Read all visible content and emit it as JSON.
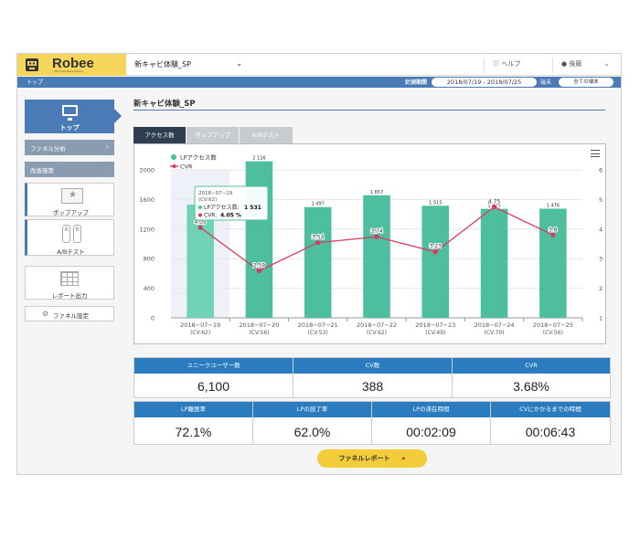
{
  "app": {
    "logo_text": "Robee",
    "logo_sub": "SPI Code Base Plugin",
    "project": "新キャビ体験_SP",
    "help": "ヘルプ",
    "user": "後藤"
  },
  "subbar": {
    "breadcrumb": "トップ",
    "period_label": "計測期間",
    "period_value": "2018/07/19 - 2018/07/25",
    "device_label": "端末",
    "device_value": "全ての端末"
  },
  "sidebar": {
    "top_label": "トップ",
    "funnel_label": "ファネル分析",
    "improve_label": "改善施策",
    "popup_label": "ポップアップ",
    "ab_label": "A/Bテスト",
    "ab_icon_a": "A",
    "ab_icon_b": "B",
    "report_label": "レポート出力",
    "setting_label": "ファネル設定"
  },
  "main": {
    "title": "新キャビ体験_SP",
    "tabs": [
      "アクセス数",
      "ポップアップ",
      "A/Bテスト"
    ]
  },
  "chart_data": {
    "type": "bar",
    "categories": [
      "2018−07−19",
      "2018−07−20",
      "2018−07−21",
      "2018−07−22",
      "2018−07−23",
      "2018−07−24",
      "2018−07−25"
    ],
    "cv_labels": [
      "(CV:62)",
      "(CV:56)",
      "(CV:53)",
      "(CV:62)",
      "(CV:49)",
      "(CV:70)",
      "(CV:56)"
    ],
    "series": [
      {
        "name": "LPアクセス数",
        "type": "bar",
        "axis": "left",
        "color": "#4dbf9e",
        "values": [
          1531,
          2116,
          1497,
          1657,
          1515,
          1473,
          1476
        ]
      },
      {
        "name": "CVR",
        "type": "line",
        "axis": "right",
        "color": "#d93a63",
        "values": [
          4.05,
          2.59,
          3.54,
          3.74,
          3.23,
          4.75,
          3.8
        ]
      }
    ],
    "bar_labels": [
      "1 531",
      "2 116",
      "1 497",
      "1 657",
      "1 515",
      "1 473",
      "1 476"
    ],
    "line_labels": [
      "4.05",
      "2.59",
      "3.54",
      "3.74",
      "3.23",
      "4.75",
      "3.8"
    ],
    "ylim_left": [
      0,
      2000
    ],
    "yticks_left": [
      "0",
      "400",
      "800",
      "1200",
      "1600",
      "2000"
    ],
    "ylim_right": [
      1,
      6
    ],
    "yticks_right": [
      "1",
      "2",
      "3",
      "4",
      "5",
      "6"
    ],
    "legend_position": "top-left",
    "tooltip": {
      "date": "2018−07−19",
      "cv": "(CV:62)",
      "access_label": "LPアクセス数:",
      "access_value": "1 531",
      "cvr_label": "CVR:",
      "cvr_value": "4.05 %"
    }
  },
  "kpi_row1": [
    {
      "label": "ユニークユーザー数",
      "value": "6,100"
    },
    {
      "label": "CV数",
      "value": "388"
    },
    {
      "label": "CVR",
      "value": "3.68%"
    }
  ],
  "kpi_row2": [
    {
      "label": "LP離脱率",
      "value": "72.1%"
    },
    {
      "label": "LPの読了率",
      "value": "62.0%"
    },
    {
      "label": "LPの滞在時間",
      "value": "00:02:09"
    },
    {
      "label": "CVにかかるまでの時間",
      "value": "00:06:43"
    }
  ],
  "report_button": "ファネルレポート"
}
